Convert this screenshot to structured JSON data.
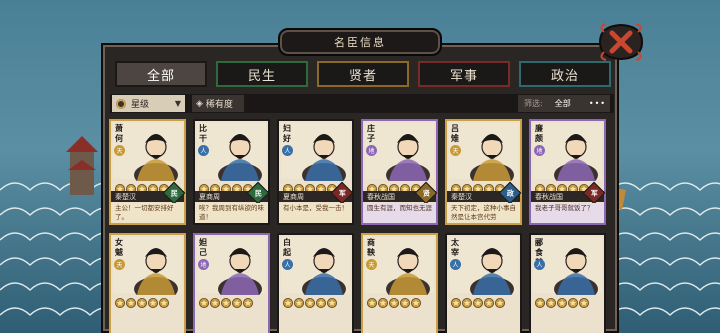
{
  "title": "名臣信息",
  "tabs": [
    {
      "label": "全部",
      "active": true,
      "color": "#4c4541"
    },
    {
      "label": "民生",
      "active": false,
      "color": "#2e6a3d"
    },
    {
      "label": "贤者",
      "active": false,
      "color": "#8a6a26"
    },
    {
      "label": "军事",
      "active": false,
      "color": "#7a2a25"
    },
    {
      "label": "政治",
      "active": false,
      "color": "#2d6a6f"
    }
  ],
  "filters": {
    "rank_label": "星级",
    "rarity_label": "稀有度",
    "screen_label": "筛选:",
    "screen_value": "全部"
  },
  "cards": [
    {
      "name": "萧何",
      "element": "天",
      "element_color": "#c89a36",
      "stars": 5,
      "dynasty": "秦楚汉",
      "type": "民",
      "type_color": "#2e6a3d",
      "quote": "主公！一切都安排好了。",
      "frame": "gold"
    },
    {
      "name": "比干",
      "element": "人",
      "element_color": "#3a6fa8",
      "stars": 5,
      "dynasty": "夏商周",
      "type": "民",
      "type_color": "#2e6a3d",
      "quote": "唉？我周到有纵欲的味道！",
      "frame": "dark"
    },
    {
      "name": "妇好",
      "element": "人",
      "element_color": "#3a6fa8",
      "stars": 5,
      "dynasty": "夏商周",
      "type": "军",
      "type_color": "#7a2a25",
      "quote": "有小本是，受我一击！",
      "frame": "dark"
    },
    {
      "name": "庄子",
      "element": "地",
      "element_color": "#8c67b4",
      "stars": 5,
      "dynasty": "春秋战国",
      "type": "贤",
      "type_color": "#8a6a26",
      "quote": "圆生有涯，而知也无涯",
      "frame": "purple"
    },
    {
      "name": "吕雉",
      "element": "天",
      "element_color": "#c89a36",
      "stars": 5,
      "dynasty": "秦楚汉",
      "type": "政",
      "type_color": "#2d5e8a",
      "quote": "天下初定，这种小事自然是让本宫代劳",
      "frame": "gold"
    },
    {
      "name": "廉颇",
      "element": "地",
      "element_color": "#8c67b4",
      "stars": 5,
      "dynasty": "春秋战国",
      "type": "军",
      "type_color": "#7a2a25",
      "quote": "我老子哥哥就饭了？",
      "frame": "purple"
    },
    {
      "name": "女魃",
      "element": "天",
      "element_color": "#c89a36",
      "stars": 5,
      "frame": "gold"
    },
    {
      "name": "妲己",
      "element": "地",
      "element_color": "#8c67b4",
      "stars": 5,
      "frame": "purple"
    },
    {
      "name": "白起",
      "element": "人",
      "element_color": "#3a6fa8",
      "stars": 5,
      "frame": "dark"
    },
    {
      "name": "商鞅",
      "element": "天",
      "element_color": "#c89a36",
      "stars": 5,
      "frame": "gold"
    },
    {
      "name": "太宰",
      "element": "人",
      "element_color": "#3a6fa8",
      "stars": 5,
      "frame": "dark"
    },
    {
      "name": "郦食其",
      "element": "人",
      "element_color": "#3a6fa8",
      "stars": 5,
      "frame": "dark"
    }
  ]
}
